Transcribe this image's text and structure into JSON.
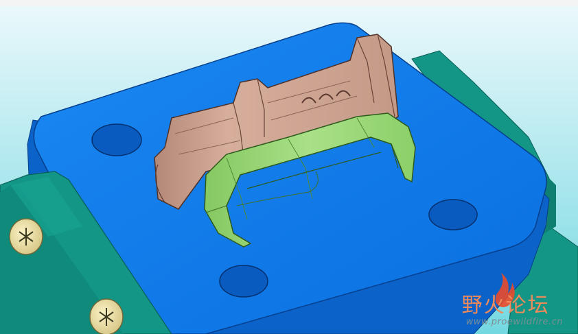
{
  "scene": {
    "description_label": "",
    "colors": {
      "background_top": "#e6f7fb",
      "background_bottom": "#74d8e1",
      "base_plate": "#0c73e6",
      "base_plate_side": "#0a5fc0",
      "teal_block": "#139585",
      "teal_block_dark": "#0b6e63",
      "core_part": "#c9a08d",
      "core_part_shade": "#a47d6c",
      "green_part": "#9fd87a",
      "green_part_shade": "#6db34a"
    },
    "icons": [
      "screw-head-icon",
      "screw-head-icon"
    ]
  },
  "watermark": {
    "title": "野火论坛",
    "url": "www.proewildfire.cn",
    "flame_color": "#ea4b2a"
  }
}
